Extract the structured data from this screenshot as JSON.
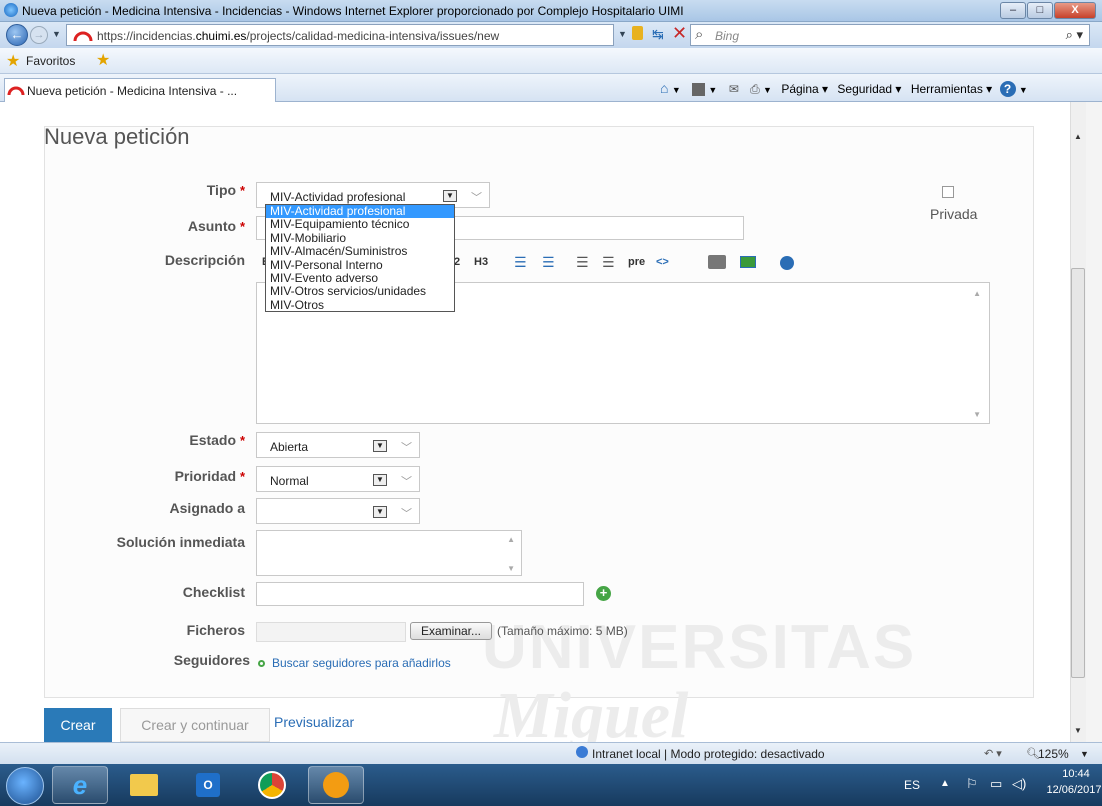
{
  "window": {
    "title": "Nueva petición - Medicina Intensiva - Incidencias - Windows Internet Explorer proporcionado por Complejo Hospitalario UIMI",
    "min": "–",
    "max": "□",
    "close": "X"
  },
  "nav": {
    "url_prefix": "https://incidencias.",
    "url_domain": "chuimi.es",
    "url_path": "/projects/calidad-medicina-intensiva/issues/new",
    "search_placeholder": "Bing"
  },
  "favorites": {
    "label": "Favoritos"
  },
  "tab": {
    "label": "Nueva petición - Medicina Intensiva - ..."
  },
  "commandbar": {
    "page": "Página ▾",
    "security": "Seguridad ▾",
    "tools": "Herramientas ▾"
  },
  "page": {
    "title": "Nueva petición"
  },
  "form": {
    "tipo": {
      "label": "Tipo",
      "value": "MIV-Actividad profesional",
      "options": [
        "MIV-Actividad profesional",
        "MIV-Equipamiento técnico",
        "MIV-Mobiliario",
        "MIV-Almacén/Suministros",
        "MIV-Personal Interno",
        "MIV-Evento adverso",
        "MIV-Otros servicios/unidades",
        "MIV-Otros"
      ]
    },
    "private": {
      "label": "Privada"
    },
    "asunto": {
      "label": "Asunto"
    },
    "descripcion": {
      "label": "Descripción",
      "toolbar": {
        "h2": "2",
        "h3": "H3",
        "pre": "pre",
        "code": "<>"
      }
    },
    "estado": {
      "label": "Estado",
      "value": "Abierta"
    },
    "prioridad": {
      "label": "Prioridad",
      "value": "Normal"
    },
    "asignado": {
      "label": "Asignado a",
      "value": ""
    },
    "solucion": {
      "label": "Solución inmediata"
    },
    "checklist": {
      "label": "Checklist"
    },
    "ficheros": {
      "label": "Ficheros",
      "browse": "Examinar...",
      "max_size": "(Tamaño máximo: 5 MB)"
    },
    "seguidores": {
      "label": "Seguidores",
      "link": "Buscar seguidores para añadirlos"
    },
    "required_mark": "*"
  },
  "buttons": {
    "create": "Crear",
    "create_continue": "Crear y continuar",
    "preview": "Previsualizar"
  },
  "watermark": {
    "line1": "UNIVERSITAS",
    "line2": "Miguel"
  },
  "status": {
    "zone": "Intranet local | Modo protegido: desactivado",
    "zoom": "125%"
  },
  "taskbar": {
    "lang": "ES",
    "time": "10:44",
    "date": "12/06/2017"
  },
  "colors": {
    "accent": "#2a7ab8",
    "link": "#2a6db5",
    "required": "#cc0000",
    "add_green": "#46a546"
  }
}
